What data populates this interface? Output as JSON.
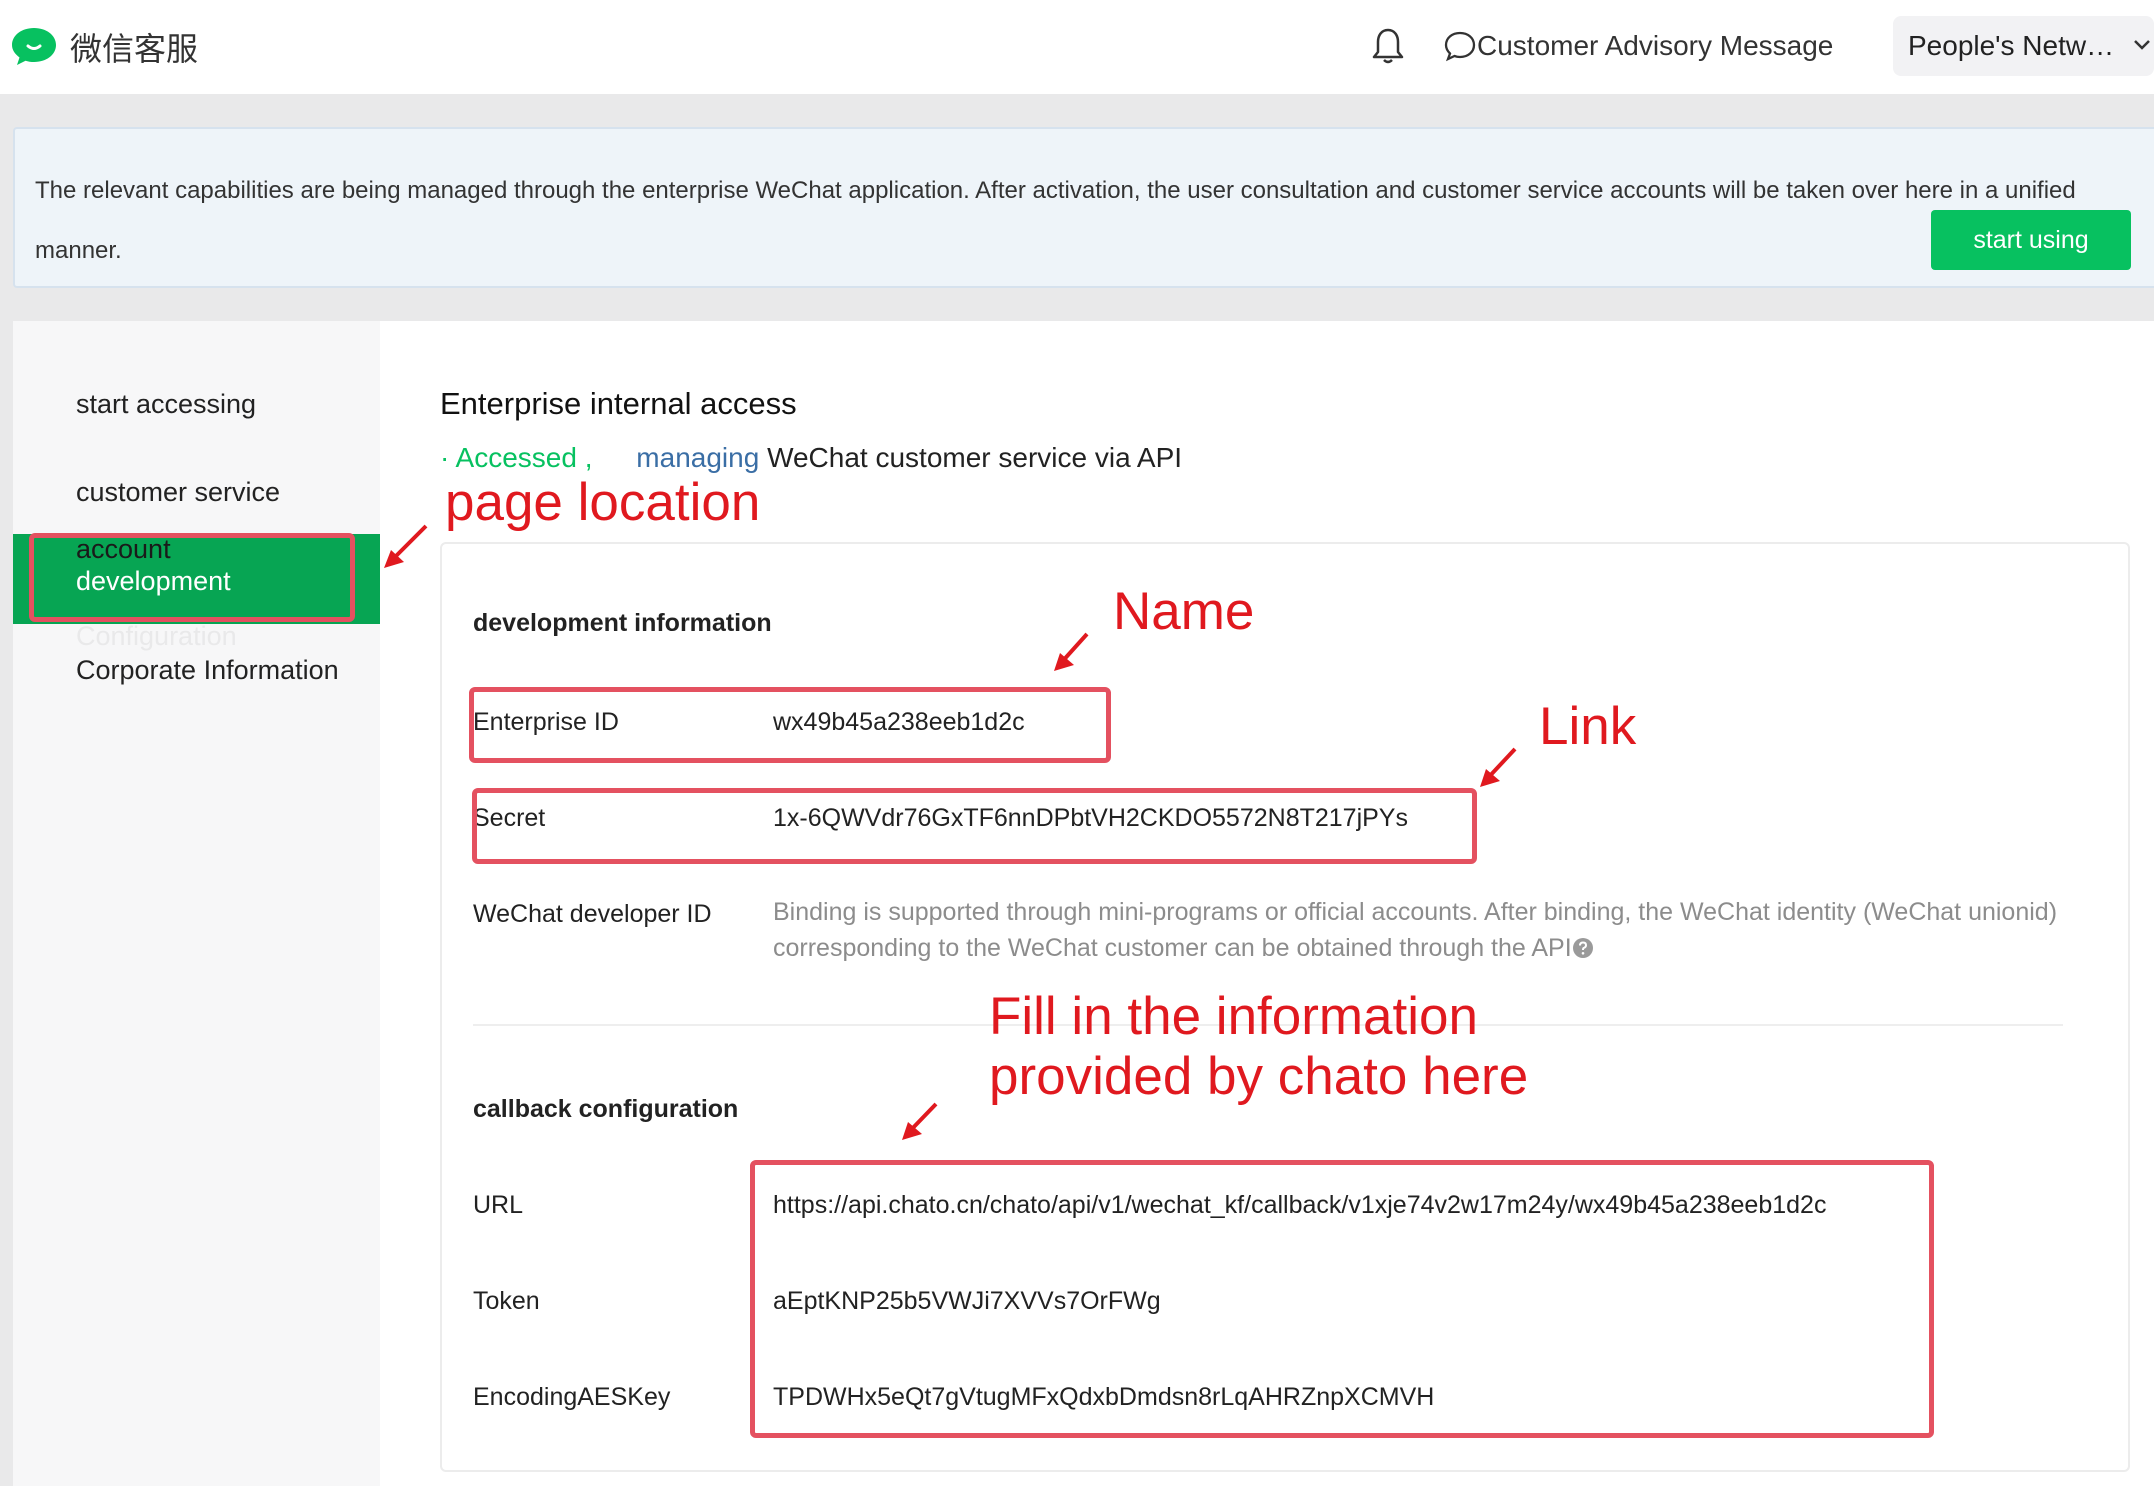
{
  "header": {
    "brand": "微信客服",
    "notification_icon": "bell-icon",
    "message_icon": "speech-bubble-icon",
    "advisory_label": "Customer Advisory Message",
    "account_name": "People's Netw…",
    "account_chevron_icon": "chevron-down-icon"
  },
  "notice": {
    "text": "The relevant capabilities are being managed through the enterprise WeChat application. After activation, the user consultation and customer service accounts will be taken over here in a unified manner.",
    "button": "start using"
  },
  "sidebar": {
    "items": [
      "start accessing",
      "customer service"
    ],
    "active_line1": "account",
    "active_line2": "development",
    "hidden_item": "Configuration",
    "last_item": "Corporate Information"
  },
  "content": {
    "title": "Enterprise internal access",
    "status_accessed": "· Accessed ,",
    "status_managing": "managing",
    "status_rest": "WeChat customer service via API",
    "dev_heading": "development information",
    "enterprise_id_label": "Enterprise ID",
    "enterprise_id_value": "wx49b45a238eeb1d2c",
    "secret_label": "Secret",
    "secret_value": "1x-6QWVdr76GxTF6nnDPbtVH2CKDO5572N8T217jPYs",
    "developer_id_label": "WeChat developer ID",
    "developer_id_desc": "Binding is supported through mini-programs or official accounts. After binding, the WeChat identity (WeChat unionid) corresponding to the WeChat customer can be obtained through the API",
    "callback_heading": "callback configuration",
    "url_label": "URL",
    "url_value": "https://api.chato.cn/chato/api/v1/wechat_kf/callback/v1xje74v2w17m24y/wx49b45a238eeb1d2c",
    "token_label": "Token",
    "token_value": "aEptKNP25b5VWJi7XVVs7OrFWg",
    "aes_label": "EncodingAESKey",
    "aes_value": "TPDWHx5eQt7gVtugMFxQdxbDmdsn8rLqAHRZnpXCMVH"
  },
  "annotations": {
    "page_location": "page location",
    "name": "Name",
    "link": "Link",
    "fill_in_line1": "Fill in the information",
    "fill_in_line2": "provided by chato here"
  },
  "colors": {
    "accent_green": "#07c160",
    "active_nav_green": "#07a553",
    "annotation_red": "#e0191f",
    "annotation_box": "#e45160"
  }
}
